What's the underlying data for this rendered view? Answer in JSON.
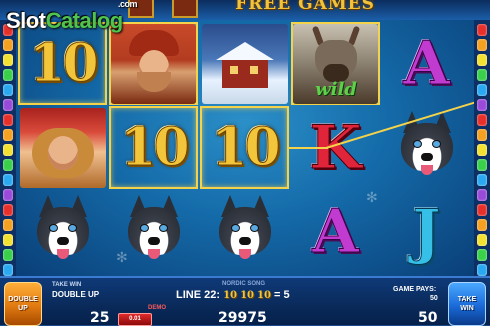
{
  "watermark": {
    "brand_slot": "Slot",
    "brand_catalog": "Catalog",
    "domain": ".com"
  },
  "header": {
    "title": "FREE GAMES"
  },
  "reels": {
    "row1": [
      "10",
      "man-portrait",
      "cabin",
      "reindeer-wild",
      "A"
    ],
    "row2": [
      "woman-portrait",
      "10",
      "10",
      "K",
      "husky"
    ],
    "row3": [
      "husky",
      "husky",
      "husky",
      "A",
      "J"
    ],
    "wild_label": "wild"
  },
  "symbols": {
    "ten": "10",
    "a": "A",
    "k": "K",
    "j": "J"
  },
  "panel": {
    "double_up_button": [
      "DOUBLE",
      "UP"
    ],
    "take_win_label": "TAKE WIN",
    "double_up_label": "DOUBLE UP",
    "left_value": "25",
    "coin_value": "0.01",
    "demo_label": "DEMO",
    "nordic_label": "NORDIC SONG",
    "line_prefix": "LINE 22:",
    "line_symbols": [
      "10",
      "10",
      "10"
    ],
    "line_result": "= 5",
    "balance": "29975",
    "game_pays_label": "GAME PAYS:",
    "game_pays_value": "50",
    "win_value": "50",
    "take_win_button": [
      "TAKE",
      "WIN"
    ]
  },
  "colors": {
    "win_frame": "#f4d34a",
    "ten_gold": "#f3c53a",
    "a_purple": "#c13bd1",
    "k_red": "#e0243a",
    "j_cyan": "#36c0e8"
  }
}
